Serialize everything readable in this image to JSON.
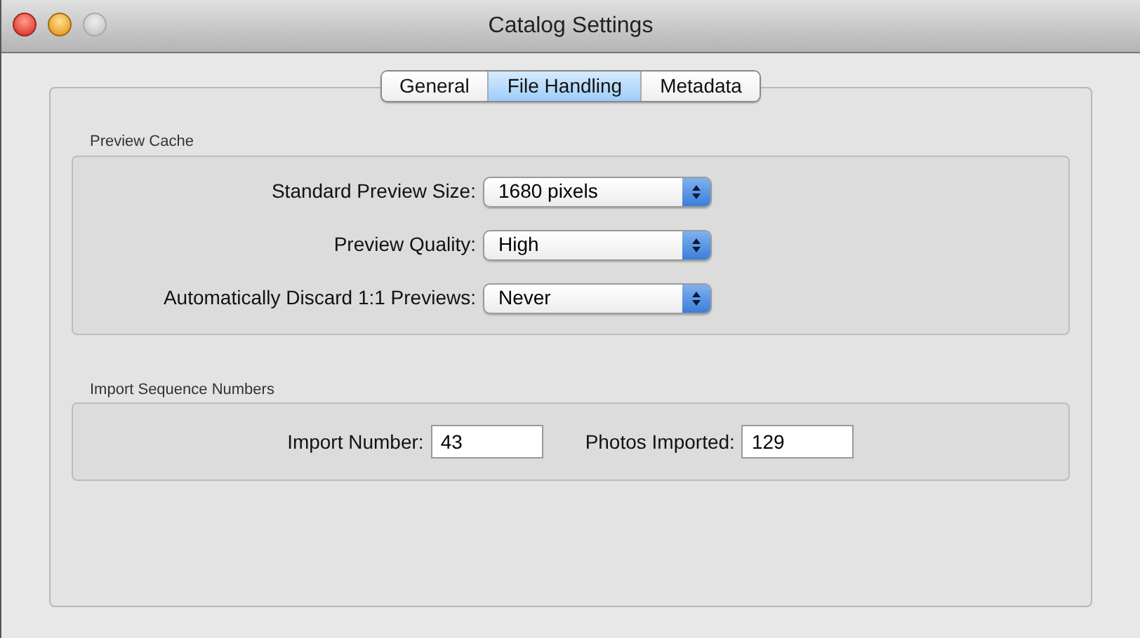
{
  "window": {
    "title": "Catalog Settings"
  },
  "tabs": [
    {
      "label": "General",
      "selected": false
    },
    {
      "label": "File Handling",
      "selected": true
    },
    {
      "label": "Metadata",
      "selected": false
    }
  ],
  "preview_cache": {
    "title": "Preview Cache",
    "rows": [
      {
        "label": "Standard Preview Size:",
        "value": "1680 pixels"
      },
      {
        "label": "Preview Quality:",
        "value": "High"
      },
      {
        "label": "Automatically Discard 1:1 Previews:",
        "value": "Never"
      }
    ]
  },
  "import_sequence": {
    "title": "Import Sequence Numbers",
    "fields": [
      {
        "label": "Import Number:",
        "value": "43"
      },
      {
        "label": "Photos Imported:",
        "value": "129"
      }
    ]
  }
}
